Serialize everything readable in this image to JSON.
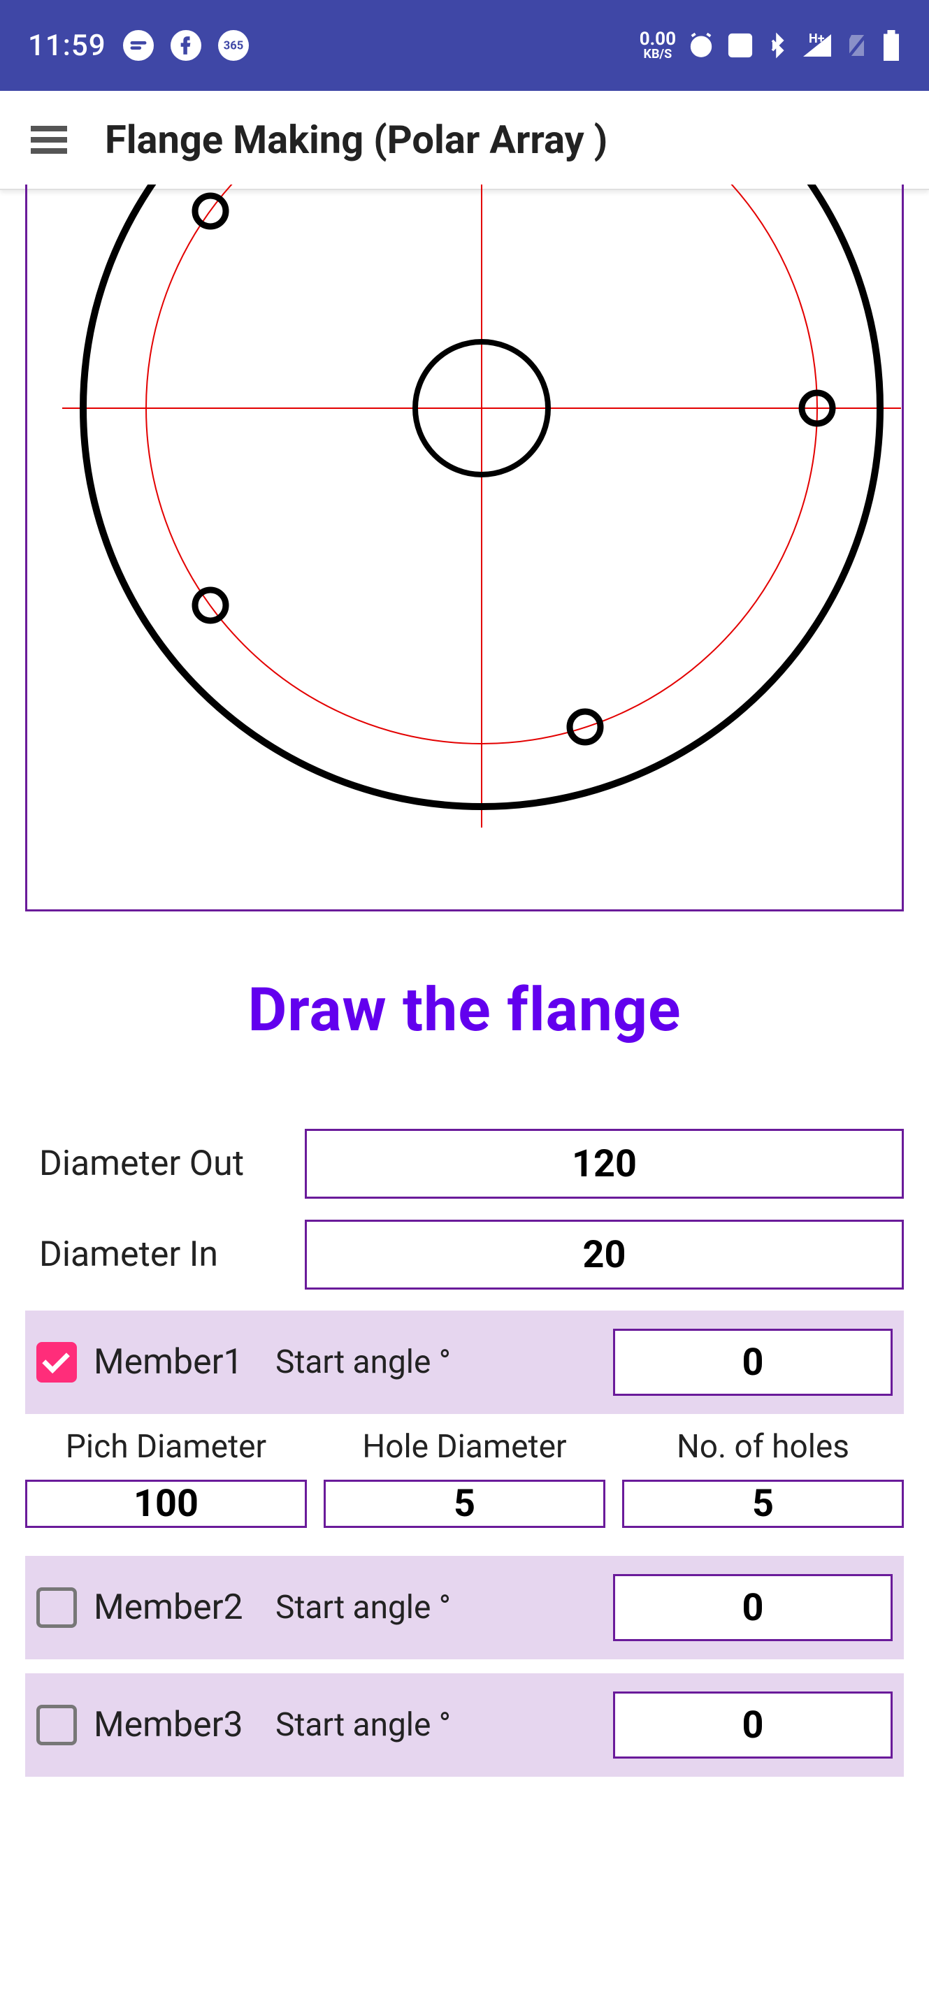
{
  "status": {
    "time": "11:59",
    "kbs_top": "0.00",
    "kbs_bot": "KB/S",
    "signal_label": "H+"
  },
  "app": {
    "title": "Flange Making (Polar Array )"
  },
  "heading": "Draw the flange",
  "form": {
    "diameter_out_label": "Diameter Out",
    "diameter_out_value": "120",
    "diameter_in_label": "Diameter In",
    "diameter_in_value": "20"
  },
  "member1": {
    "label": "Member1",
    "checked": true,
    "start_angle_label": "Start angle °",
    "start_angle_value": "0",
    "pitch_label": "Pich Diameter",
    "pitch_value": "100",
    "hole_label": "Hole Diameter",
    "hole_value": "5",
    "count_label": "No. of holes",
    "count_value": "5"
  },
  "member2": {
    "label": "Member2",
    "checked": false,
    "start_angle_label": "Start angle °",
    "start_angle_value": "0"
  },
  "member3": {
    "label": "Member3",
    "checked": false,
    "start_angle_label": "Start angle °",
    "start_angle_value": "0"
  }
}
